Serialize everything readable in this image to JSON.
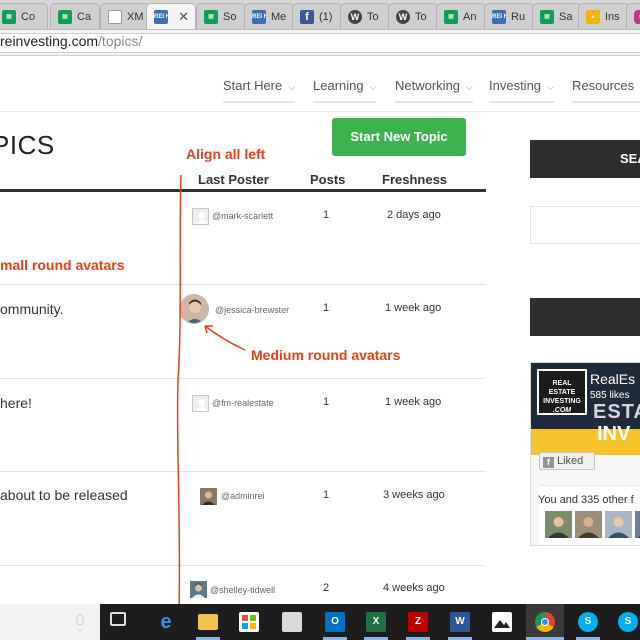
{
  "browser": {
    "tabs": [
      {
        "label": "Co",
        "favicon": "sheets-icon",
        "color": "#0f9d58"
      },
      {
        "label": "Ca",
        "favicon": "sheets-icon",
        "color": "#0f9d58"
      },
      {
        "label": "XM",
        "favicon": "document-icon",
        "color": "#9e9e9e"
      },
      {
        "label": "",
        "favicon": "reihow-icon",
        "color": "#3b6fb6",
        "active": true
      },
      {
        "label": "So",
        "favicon": "sheets-icon",
        "color": "#0f9d58"
      },
      {
        "label": "Me",
        "favicon": "reihow-icon",
        "color": "#3b6fb6"
      },
      {
        "label": "(1)",
        "favicon": "facebook-icon",
        "color": "#3b5998"
      },
      {
        "label": "To",
        "favicon": "wordpress-icon",
        "color": "#464646"
      },
      {
        "label": "To",
        "favicon": "wordpress-icon",
        "color": "#464646"
      },
      {
        "label": "An",
        "favicon": "sheets-icon",
        "color": "#0f9d58"
      },
      {
        "label": "Ru",
        "favicon": "reihow-icon",
        "color": "#3b6fb6"
      },
      {
        "label": "Sa",
        "favicon": "sheets-icon",
        "color": "#0f9d58"
      },
      {
        "label": "Ins",
        "favicon": "drive-icon",
        "color": "#f4b400"
      },
      {
        "label": "",
        "favicon": "instagram-icon",
        "color": "#c13584"
      }
    ],
    "favicon_text": "REI HOW",
    "url_host": "reinvesting.com",
    "url_path": "/topics/"
  },
  "nav": {
    "items": [
      "Start Here",
      "Learning",
      "Networking",
      "Investing",
      "Resources"
    ]
  },
  "page": {
    "title": "PICS",
    "start_button": "Start New Topic"
  },
  "table": {
    "headers": {
      "last_poster": "Last Poster",
      "posts": "Posts",
      "freshness": "Freshness"
    },
    "rows": [
      {
        "title": "",
        "poster": "@mark-scarlett",
        "posts": "1",
        "freshness": "2 days ago",
        "avatar": "default"
      },
      {
        "title": "ommunity.",
        "poster": "@jessica-brewster",
        "posts": "1",
        "freshness": "1 week ago",
        "avatar": "medium"
      },
      {
        "title": "here!",
        "poster": "@fm-realestate",
        "posts": "1",
        "freshness": "1 week ago",
        "avatar": "default"
      },
      {
        "title": " about to be released",
        "poster": "@adminrei",
        "posts": "1",
        "freshness": "3 weeks ago",
        "avatar": "photo"
      },
      {
        "title": "",
        "poster": "@shelley-tidwell",
        "posts": "2",
        "freshness": "4 weeks ago",
        "avatar": "photo"
      }
    ]
  },
  "annotations": {
    "align": "Align all left",
    "small": "mall round avatars",
    "medium": "Medium round avatars",
    "color": "#e8401c"
  },
  "sidebar": {
    "search_label": "SEA",
    "fb": {
      "logo_lines": [
        "REAL",
        "ESTATE",
        "INVESTING",
        ".COM"
      ],
      "name": "RealEs",
      "likes": "585 likes",
      "cover_text_1": "ESTA",
      "cover_text_2": "INV",
      "liked_label": "Liked",
      "friends_text": "You and 335 other f"
    }
  },
  "taskbar": {
    "apps": [
      {
        "name": "task-view-icon",
        "label": ""
      },
      {
        "name": "edge-icon",
        "label": "e"
      },
      {
        "name": "file-explorer-icon",
        "label": ""
      },
      {
        "name": "store-icon",
        "label": ""
      },
      {
        "name": "onedrive-icon",
        "label": ""
      },
      {
        "name": "outlook-icon",
        "label": "O"
      },
      {
        "name": "excel-icon",
        "label": "X"
      },
      {
        "name": "filezilla-icon",
        "label": "Z"
      },
      {
        "name": "word-icon",
        "label": "W"
      },
      {
        "name": "photos-icon",
        "label": ""
      },
      {
        "name": "chrome-icon",
        "label": ""
      },
      {
        "name": "skype-icon",
        "label": "S"
      },
      {
        "name": "skype-business-icon",
        "label": "S"
      }
    ]
  }
}
